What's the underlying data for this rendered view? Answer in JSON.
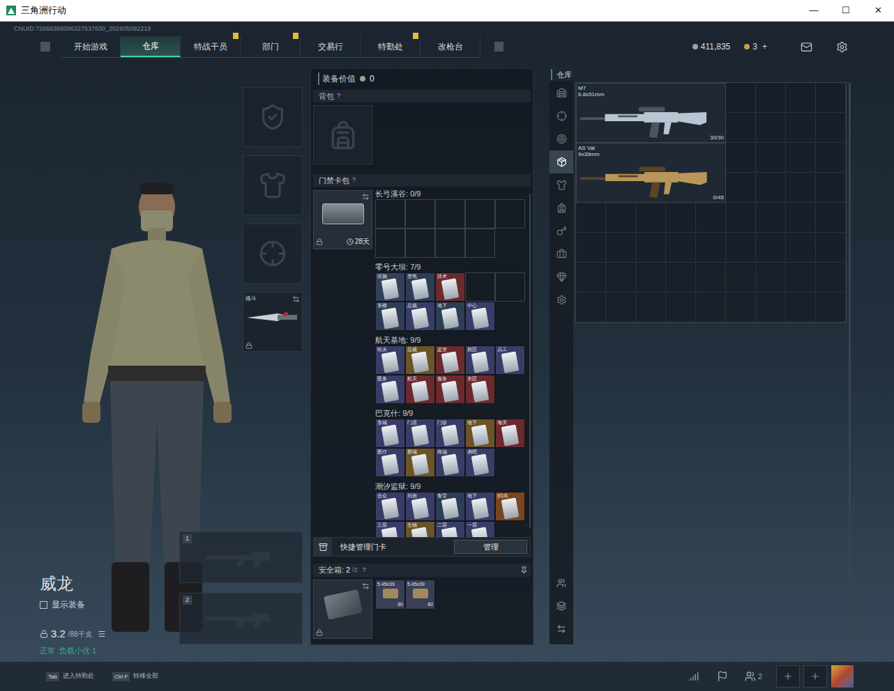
{
  "window": {
    "title": "三角洲行动",
    "controls": [
      "—",
      "☐",
      "✕"
    ]
  },
  "uid": "CNUID:72666368086327637830_202605092219",
  "nav": {
    "tabs": [
      {
        "label": "开始游戏",
        "selected": false,
        "badge": false
      },
      {
        "label": "仓库",
        "selected": true,
        "badge": false
      },
      {
        "label": "特战干员",
        "selected": false,
        "badge": true
      },
      {
        "label": "部门",
        "selected": false,
        "badge": true
      },
      {
        "label": "交易行",
        "selected": false,
        "badge": false
      },
      {
        "label": "特勤处",
        "selected": false,
        "badge": true
      },
      {
        "label": "改枪台",
        "selected": false,
        "badge": false
      }
    ]
  },
  "currency": {
    "coins": "411,835",
    "tickets": "3",
    "add": "+"
  },
  "operator": {
    "name": "威龙",
    "show_gear": {
      "label": "显示装备",
      "checked": false
    },
    "weight": "3.2",
    "weight_max": "/88千克",
    "status": [
      "正常",
      "负载小优 1"
    ]
  },
  "gear_slots": [
    {
      "kind": "helmet",
      "label": "",
      "locked": false
    },
    {
      "kind": "armor",
      "label": "",
      "locked": false
    },
    {
      "kind": "pistol",
      "label": "",
      "locked": false
    },
    {
      "kind": "melee",
      "label": "格斗",
      "locked": true
    }
  ],
  "weapon_slots": [
    "1",
    "2"
  ],
  "loadout": {
    "value_label": "装备价值",
    "value": "0",
    "backpack": {
      "label": "背包",
      "help": "?"
    },
    "keycard_bag": {
      "label": "门禁卡包",
      "help": "?",
      "duration": "28天",
      "locked": true
    },
    "maps": [
      {
        "name": "长弓溪谷",
        "count": "0/9",
        "cards": [
          {
            "filled": false,
            "label": "",
            "color": ""
          },
          {
            "filled": false,
            "label": "",
            "color": ""
          },
          {
            "filled": false,
            "label": "",
            "color": ""
          },
          {
            "filled": false,
            "label": "",
            "color": ""
          },
          {
            "filled": false,
            "label": "",
            "color": ""
          },
          {
            "filled": false,
            "label": "",
            "color": ""
          },
          {
            "filled": false,
            "label": "",
            "color": ""
          },
          {
            "filled": false,
            "label": "",
            "color": ""
          },
          {
            "filled": false,
            "label": "",
            "color": ""
          }
        ]
      },
      {
        "name": "零号大坝",
        "count": "7/9",
        "cards": [
          {
            "filled": true,
            "label": "设施",
            "color": "#34405a"
          },
          {
            "filled": true,
            "label": "变电",
            "color": "#2d3d55"
          },
          {
            "filled": true,
            "label": "技术",
            "color": "#6b2a2e"
          },
          {
            "filled": false,
            "label": "",
            "color": ""
          },
          {
            "filled": false,
            "label": "",
            "color": ""
          },
          {
            "filled": true,
            "label": "东楼",
            "color": "#2d3d55"
          },
          {
            "filled": true,
            "label": "总裁",
            "color": "#3a3c68"
          },
          {
            "filled": true,
            "label": "地下",
            "color": "#2d3d55"
          },
          {
            "filled": true,
            "label": "中心",
            "color": "#3a3c68"
          }
        ]
      },
      {
        "name": "航天基地",
        "count": "9/9",
        "cards": [
          {
            "filled": true,
            "label": "哈夫",
            "color": "#3a3c68"
          },
          {
            "filled": true,
            "label": "总裁",
            "color": "#6a5428"
          },
          {
            "filled": true,
            "label": "蓝室",
            "color": "#6b2a2e"
          },
          {
            "filled": true,
            "label": "西区",
            "color": "#3a3c68"
          },
          {
            "filled": true,
            "label": "员工",
            "color": "#3a3c68"
          },
          {
            "filled": true,
            "label": "医务",
            "color": "#3a3c68"
          },
          {
            "filled": true,
            "label": "航天",
            "color": "#6b2a2e"
          },
          {
            "filled": true,
            "label": "服务",
            "color": "#6b2a2e"
          },
          {
            "filled": true,
            "label": "东区",
            "color": "#6b2a2e"
          }
        ]
      },
      {
        "name": "巴克什",
        "count": "9/9",
        "cards": [
          {
            "filled": true,
            "label": "东城",
            "color": "#3a3c68"
          },
          {
            "filled": true,
            "label": "门店",
            "color": "#3a3c68"
          },
          {
            "filled": true,
            "label": "门诊",
            "color": "#3a3c68"
          },
          {
            "filled": true,
            "label": "地下",
            "color": "#6a5428"
          },
          {
            "filled": true,
            "label": "海滨",
            "color": "#6b2a2e"
          },
          {
            "filled": true,
            "label": "医疗",
            "color": "#3a3c68"
          },
          {
            "filled": true,
            "label": "新城",
            "color": "#6a5428"
          },
          {
            "filled": true,
            "label": "商场",
            "color": "#3a3c68"
          },
          {
            "filled": true,
            "label": "酒吧",
            "color": "#3a3c68"
          }
        ]
      },
      {
        "name": "潮汐监狱",
        "count": "9/9",
        "cards": [
          {
            "filled": true,
            "label": "合众",
            "color": "#3a3c68"
          },
          {
            "filled": true,
            "label": "刑房",
            "color": "#3a3c68"
          },
          {
            "filled": true,
            "label": "食堂",
            "color": "#2d3d55"
          },
          {
            "filled": true,
            "label": "地下",
            "color": "#3a3c68"
          },
          {
            "filled": true,
            "label": "(特殊",
            "color": "#7a4620"
          },
          {
            "filled": true,
            "label": "三层",
            "color": "#3a3c68"
          },
          {
            "filled": true,
            "label": "生物",
            "color": "#6a5428"
          },
          {
            "filled": true,
            "label": "二层",
            "color": "#3a3c68"
          },
          {
            "filled": true,
            "label": "一层",
            "color": "#3a3c68"
          }
        ]
      }
    ],
    "quick_manage": {
      "label": "快捷管理门卡",
      "button": "管理"
    },
    "safe": {
      "label": "安全箱:",
      "count": "2",
      "max": "/2",
      "help": "?",
      "locked": true,
      "items": [
        {
          "name": "5.45x39",
          "count": "60"
        },
        {
          "name": "5.45x39",
          "count": "60"
        }
      ]
    }
  },
  "warehouse": {
    "label": "仓库",
    "categories": [
      {
        "selected": false
      },
      {
        "selected": false
      },
      {
        "selected": false
      },
      {
        "selected": true
      },
      {
        "selected": false
      },
      {
        "selected": false
      },
      {
        "selected": false
      },
      {
        "selected": false
      },
      {
        "selected": false
      },
      {
        "selected": false
      }
    ],
    "items": [
      {
        "name": "M7",
        "caliber": "6.8x51mm",
        "ammo": "30/30",
        "kind": "rifle"
      },
      {
        "name": "AS Val",
        "caliber": "9x39mm",
        "ammo": "0/45",
        "kind": "val"
      }
    ]
  },
  "bottom_bar": {
    "hints": [
      {
        "key": "Tab",
        "label": "进入特勤处"
      },
      {
        "key": "Ctrl F",
        "label": "转移全部"
      }
    ],
    "squad": "2"
  }
}
